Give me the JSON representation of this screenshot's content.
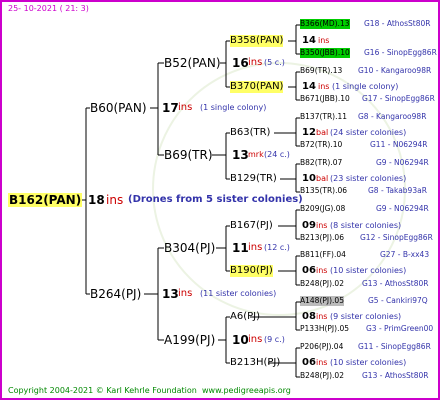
{
  "header": {
    "date": "25- 10-2021 ( 21: 3)"
  },
  "footer": {
    "copyright": "Copyright 2004-2021 © Karl Kehrle Foundation",
    "website": "www.pedigreeapis.org"
  },
  "colors": {
    "border": "#cc00cc",
    "ins_red": "#cc0000",
    "note_blue": "#3333aa",
    "highlight_yellow": "#ffff66",
    "highlight_green": "#00cc00",
    "highlight_gray": "#bbbbbb"
  },
  "root": {
    "name": "B162(PAN)",
    "num": "18",
    "ins": "ins",
    "note": "(Drones from 5 sister colonies)"
  },
  "gen2": [
    {
      "name": "B60(PAN)",
      "num": "17",
      "ins": "ins",
      "note": "(1 single colony)"
    },
    {
      "name": "B264(PJ)",
      "num": "13",
      "ins": "ins",
      "note": "(11 sister colonies)"
    }
  ],
  "gen3": [
    {
      "name": "B52(PAN)",
      "num": "16",
      "ins": "ins",
      "note": "(5 c.)"
    },
    {
      "name": "B69(TR)",
      "num": "13",
      "ins": "mrk",
      "note": "(24 c.)"
    },
    {
      "name": "B304(PJ)",
      "num": "11",
      "ins": "ins",
      "note": "(12 c.)"
    },
    {
      "name": "A199(PJ)",
      "num": "10",
      "ins": "ins",
      "note": "(9 c.)"
    }
  ],
  "gen4": [
    {
      "name": "B358(PAN)",
      "num": "14",
      "ins": "ins",
      "note": ""
    },
    {
      "name": "B370(PAN)",
      "num": "14",
      "ins": "ins",
      "note": "(1 single colony)"
    },
    {
      "name": "B63(TR)",
      "num": "12",
      "ins": "bal",
      "note": "(24 sister colonies)"
    },
    {
      "name": "B129(TR)",
      "num": "10",
      "ins": "bal",
      "note": "(23 sister colonies)"
    },
    {
      "name": "B167(PJ)",
      "num": "09",
      "ins": "ins",
      "note": "(8 sister colonies)"
    },
    {
      "name": "B190(PJ)",
      "num": "06",
      "ins": "ins",
      "note": "(10 sister colonies)"
    },
    {
      "name": "A6(PJ)",
      "num": "08",
      "ins": "ins",
      "note": "(9 sister colonies)"
    },
    {
      "name": "B213H(PJ)",
      "num": "06",
      "ins": "ins",
      "note": "(10 sister colonies)"
    }
  ],
  "gen5": [
    {
      "name": "B366(MD).13",
      "ref": "G18 - AthosSt80R"
    },
    {
      "name": "B350(JBB).10",
      "ref": "G16 - SinopEgg86R"
    },
    {
      "name": "B69(TR).13",
      "ref": "G10 - Kangaroo98R"
    },
    {
      "name": "B671(JBB).10",
      "ref": "G17 - SinopEgg86R"
    },
    {
      "name": "B137(TR).11",
      "ref": "G8 - Kangaroo98R"
    },
    {
      "name": "B72(TR).10",
      "ref": "G11 - N06294R"
    },
    {
      "name": "B82(TR).07",
      "ref": "G9 - N06294R"
    },
    {
      "name": "B135(TR).06",
      "ref": "G8 - Takab93aR"
    },
    {
      "name": "B209(JG).08",
      "ref": "G9 - N06294R"
    },
    {
      "name": "B213(PJ).06",
      "ref": "G12 - SinopEgg86R"
    },
    {
      "name": "B811(FF).04",
      "ref": "G27 - B-xx43"
    },
    {
      "name": "B248(PJ).02",
      "ref": "G13 - AthosSt80R"
    },
    {
      "name": "A148(PJ).05",
      "ref": "G5 - Cankiri97Q"
    },
    {
      "name": "P133H(PJ).05",
      "ref": "G3 - PrimGreen00"
    },
    {
      "name": "P206(PJ).04",
      "ref": "G11 - SinopEgg86R"
    },
    {
      "name": "B248(PJ).02",
      "ref": "G13 - AthosSt80R"
    }
  ]
}
